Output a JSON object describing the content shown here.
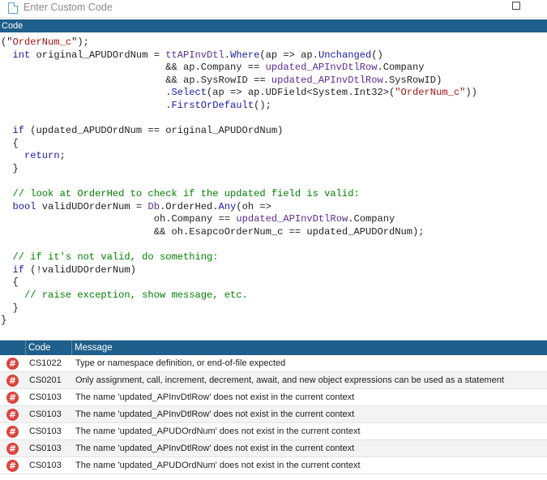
{
  "window": {
    "title": "Enter Custom Code"
  },
  "editor": {
    "header": "Code",
    "lines": [
      [
        [
          "p",
          "(\""
        ],
        [
          "str",
          "OrderNum_c"
        ],
        [
          "p",
          "\");"
        ]
      ],
      [
        [
          "p",
          "  "
        ],
        [
          "kw",
          "int"
        ],
        [
          "p",
          " original_APUDOrdNum = "
        ],
        [
          "pm",
          "ttAPInvDtl"
        ],
        [
          "p",
          "."
        ],
        [
          "kw",
          "Where"
        ],
        [
          "p",
          "(ap => ap."
        ],
        [
          "kw",
          "Unchanged"
        ],
        [
          "p",
          "()"
        ]
      ],
      [
        [
          "p",
          "                            && ap.Company == "
        ],
        [
          "pm",
          "updated_APInvDtlRow"
        ],
        [
          "p",
          ".Company"
        ]
      ],
      [
        [
          "p",
          "                            && ap.SysRowID == "
        ],
        [
          "pm",
          "updated_APInvDtlRow"
        ],
        [
          "p",
          ".SysRowID)"
        ]
      ],
      [
        [
          "p",
          "                            ."
        ],
        [
          "kw",
          "Select"
        ],
        [
          "p",
          "(ap => ap.UDField<System.Int32>("
        ],
        [
          "str",
          "\"OrderNum_c\""
        ],
        [
          "p",
          "))"
        ]
      ],
      [
        [
          "p",
          "                            ."
        ],
        [
          "kw",
          "FirstOrDefault"
        ],
        [
          "p",
          "();"
        ]
      ],
      [
        [
          "p",
          ""
        ]
      ],
      [
        [
          "p",
          "  "
        ],
        [
          "kw",
          "if"
        ],
        [
          "p",
          " (updated_APUDOrdNum == original_APUDOrdNum)"
        ]
      ],
      [
        [
          "p",
          "  {"
        ]
      ],
      [
        [
          "p",
          "    "
        ],
        [
          "kw",
          "return"
        ],
        [
          "p",
          ";"
        ]
      ],
      [
        [
          "p",
          "  }"
        ]
      ],
      [
        [
          "p",
          ""
        ]
      ],
      [
        [
          "cm",
          "  // look at OrderHed to check if the updated field is valid:"
        ]
      ],
      [
        [
          "p",
          "  "
        ],
        [
          "kw",
          "bool"
        ],
        [
          "p",
          " validUDOrderNum = "
        ],
        [
          "pm",
          "Db"
        ],
        [
          "p",
          ".OrderHed."
        ],
        [
          "kw",
          "Any"
        ],
        [
          "p",
          "(oh =>"
        ]
      ],
      [
        [
          "p",
          "                          oh.Company == "
        ],
        [
          "pm",
          "updated_APInvDtlRow"
        ],
        [
          "p",
          ".Company"
        ]
      ],
      [
        [
          "p",
          "                          && oh.EsapcoOrderNum_c == updated_APUDOrdNum);"
        ]
      ],
      [
        [
          "p",
          ""
        ]
      ],
      [
        [
          "cm",
          "  // if it's not valid, do something:"
        ]
      ],
      [
        [
          "p",
          "  "
        ],
        [
          "kw",
          "if"
        ],
        [
          "p",
          " (!validUDOrderNum)"
        ]
      ],
      [
        [
          "p",
          "  {"
        ]
      ],
      [
        [
          "cm",
          "    // raise exception, show message, etc."
        ]
      ],
      [
        [
          "p",
          "  }"
        ]
      ],
      [
        [
          "p",
          "}"
        ]
      ]
    ]
  },
  "errors": {
    "columns": {
      "code": "Code",
      "message": "Message"
    },
    "severity_symbol": "#",
    "rows": [
      {
        "code": "CS1022",
        "message": "Type or namespace definition, or end-of-file expected"
      },
      {
        "code": "CS0201",
        "message": "Only assignment, call, increment, decrement, await, and new object expressions can be used as a statement"
      },
      {
        "code": "CS0103",
        "message": "The name 'updated_APInvDtlRow' does not exist in the current context"
      },
      {
        "code": "CS0103",
        "message": "The name 'updated_APInvDtlRow' does not exist in the current context"
      },
      {
        "code": "CS0103",
        "message": "The name 'updated_APUDOrdNum' does not exist in the current context"
      },
      {
        "code": "CS0103",
        "message": "The name 'updated_APInvDtlRow' does not exist in the current context"
      },
      {
        "code": "CS0103",
        "message": "The name 'updated_APUDOrdNum' does not exist in the current context"
      }
    ]
  },
  "icons": {
    "app": "document-icon",
    "maximize": "maximize-icon",
    "error": "error-icon"
  },
  "colors": {
    "header_bg": "#1f5f8b",
    "keyword": "#1a1aa8",
    "string": "#a31515",
    "member": "#5c2d91",
    "comment": "#008000",
    "error_icon": "#d9443c"
  }
}
